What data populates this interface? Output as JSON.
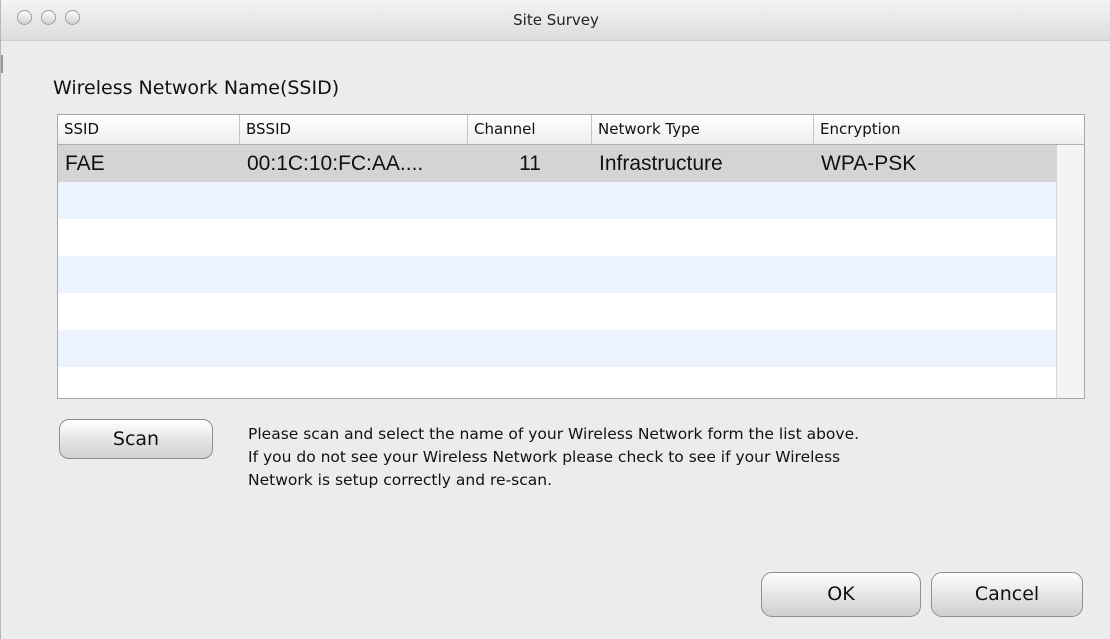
{
  "window": {
    "title": "Site Survey"
  },
  "section": {
    "label": "Wireless Network Name(SSID)"
  },
  "table": {
    "columns": [
      "SSID",
      "BSSID",
      "Channel",
      "Network Type",
      "Encryption"
    ],
    "rows": [
      {
        "ssid": "FAE",
        "bssid": "00:1C:10:FC:AA....",
        "channel": "11",
        "network_type": "Infrastructure",
        "encryption": "WPA-PSK"
      }
    ]
  },
  "scan": {
    "label": "Scan"
  },
  "help": {
    "lines": [
      "Please scan and select the name of your Wireless Network form the list above.",
      "If you do not see your Wireless Network please check to see if your Wireless",
      "Network is setup correctly and re-scan."
    ]
  },
  "buttons": {
    "ok": "OK",
    "cancel": "Cancel"
  },
  "colors": {
    "selected_row": "#d4d4d4",
    "stripe_row": "#edf3fe",
    "window_bg": "#ececec"
  },
  "icons": {
    "window_controls": [
      "close-icon",
      "minimize-icon",
      "zoom-icon"
    ]
  }
}
